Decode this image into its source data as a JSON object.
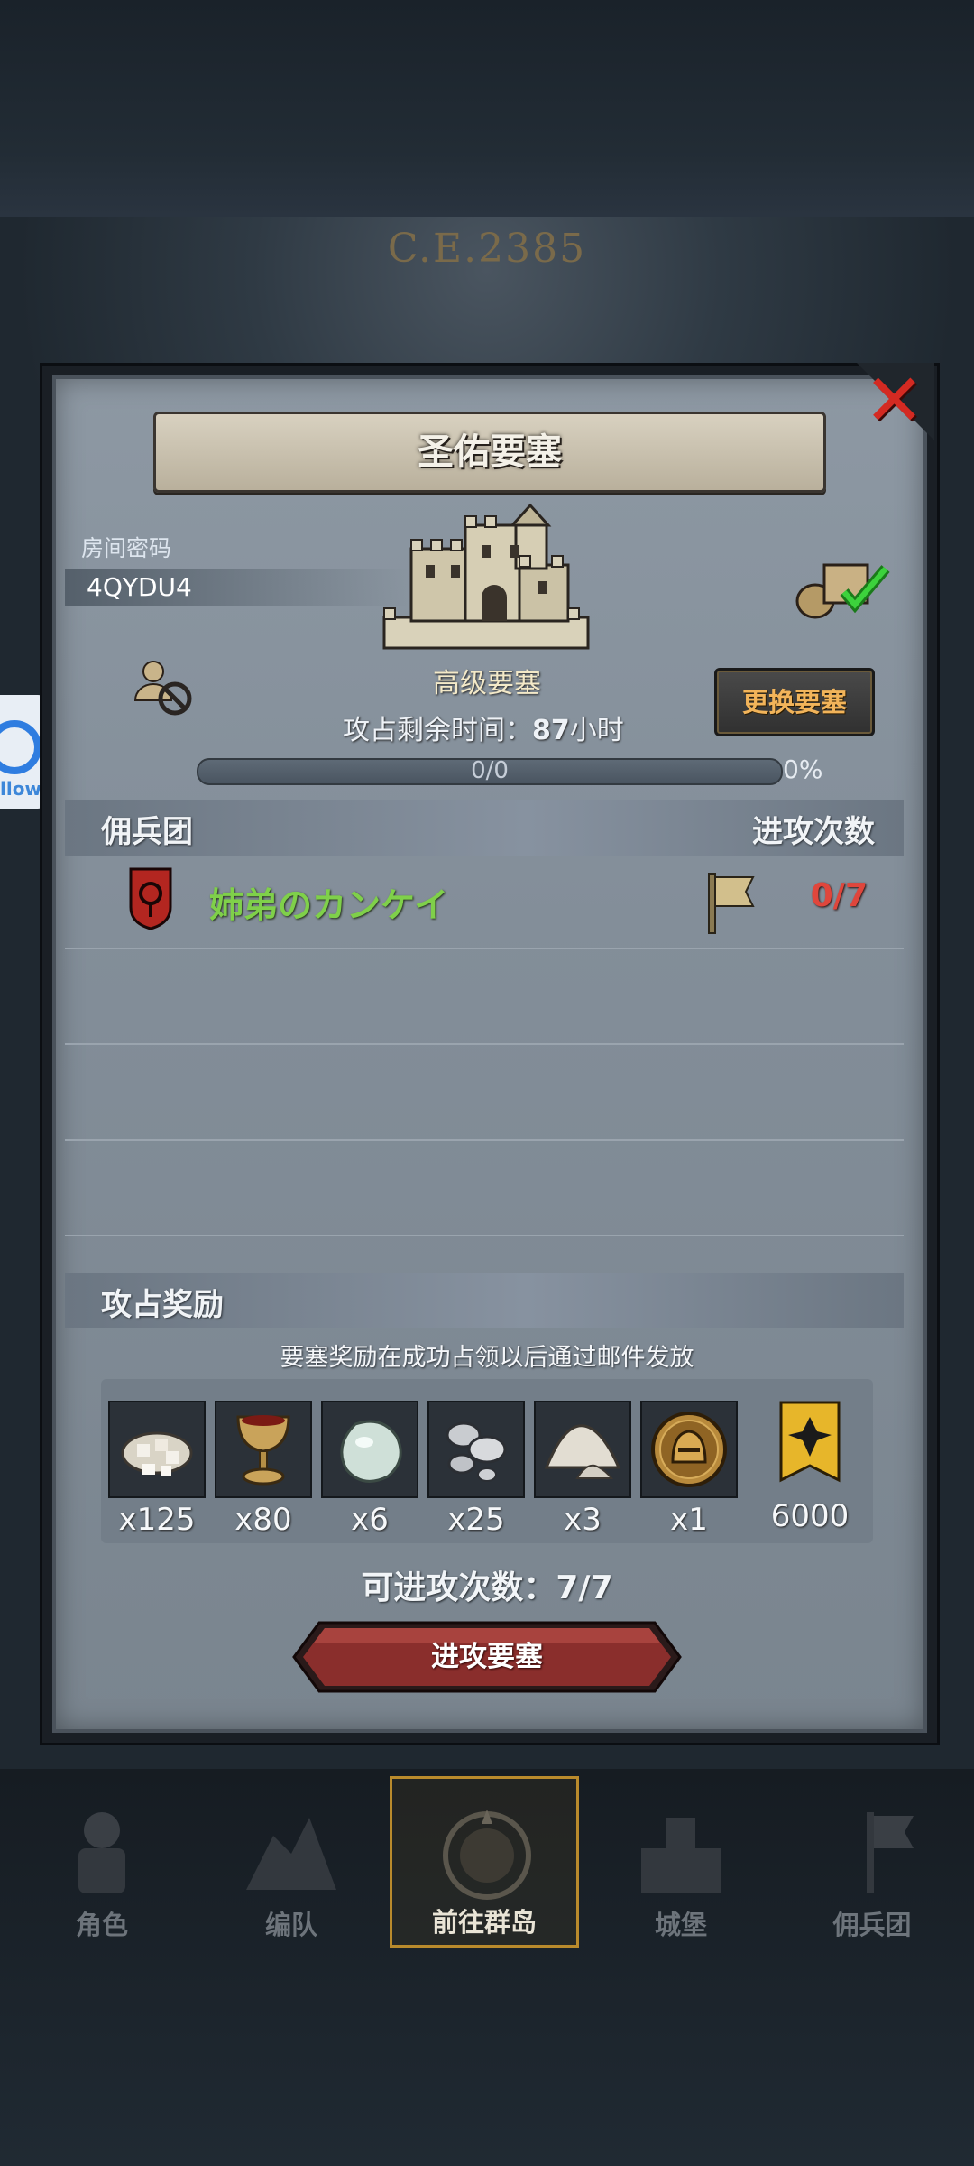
{
  "header": {
    "era_year": "C.E.2385"
  },
  "side_app": {
    "label": "llow"
  },
  "dialog": {
    "title": "圣佑要塞",
    "room": {
      "label": "房间密码",
      "code": "4QYDU4"
    },
    "fortress": {
      "grade": "高级要塞",
      "time_remaining_label": "攻占剩余时间：",
      "time_remaining_value": "87",
      "time_remaining_unit": "小时",
      "progress_text": "0/0",
      "progress_percent": "0%",
      "progress_fraction": 0,
      "change_button": "更换要塞"
    },
    "mercenary_section": {
      "label": "佣兵团",
      "count_header": "进攻次数",
      "rows": [
        {
          "name": "姉弟のカンケイ",
          "attacks": "0/7"
        }
      ]
    },
    "reward_section": {
      "label": "攻占奖励",
      "note": "要塞奖励在成功占领以后通过邮件发放",
      "items": [
        {
          "icon": "ore-pile-icon",
          "qty": "x125"
        },
        {
          "icon": "goblet-icon",
          "qty": "x80"
        },
        {
          "icon": "gem-stone-icon",
          "qty": "x6"
        },
        {
          "icon": "silver-nuggets-icon",
          "qty": "x25"
        },
        {
          "icon": "powder-pile-icon",
          "qty": "x3"
        },
        {
          "icon": "knight-helmet-coin-icon",
          "qty": "x1"
        },
        {
          "icon": "guild-banner-icon",
          "qty": "6000"
        }
      ]
    },
    "attacks_available": "可进攻次数：7/7",
    "attack_button": "进攻要塞"
  },
  "bottom_nav": {
    "items": [
      {
        "label": "角色",
        "active": false
      },
      {
        "label": "编队",
        "active": false
      },
      {
        "label": "前往群岛",
        "active": true
      },
      {
        "label": "城堡",
        "active": false
      },
      {
        "label": "佣兵团",
        "active": false
      }
    ]
  },
  "colors": {
    "mercenary_name": "#7fd04a",
    "attack_count": "#e0463c",
    "change_button_text": "#f2b45a",
    "attack_button": "#8a2e2c",
    "close_x": "#d42a22"
  }
}
